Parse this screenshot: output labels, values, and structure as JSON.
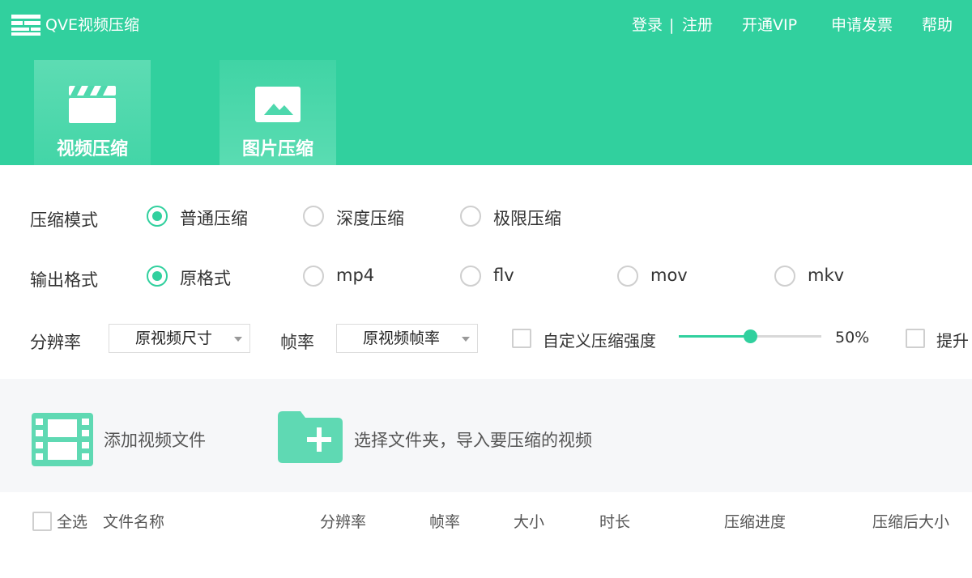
{
  "app": {
    "title": "QVE视频压缩"
  },
  "top_menu": {
    "login": "登录",
    "separator": "|",
    "register": "注册",
    "vip": "开通VIP",
    "invoice": "申请发票",
    "help": "帮助"
  },
  "tabs": [
    {
      "label": "视频压缩",
      "icon": "clapperboard-icon",
      "active": true
    },
    {
      "label": "图片压缩",
      "icon": "image-icon",
      "active": false
    }
  ],
  "compress_mode": {
    "label": "压缩模式",
    "options": [
      "普通压缩",
      "深度压缩",
      "极限压缩"
    ],
    "selected": "普通压缩"
  },
  "output_format": {
    "label": "输出格式",
    "options": [
      "原格式",
      "mp4",
      "flv",
      "mov",
      "mkv"
    ],
    "selected": "原格式"
  },
  "settings": {
    "resolution_label": "分辨率",
    "resolution_value": "原视频尺寸",
    "framerate_label": "帧率",
    "framerate_value": "原视频帧率",
    "custom_strength_label": "自定义压缩强度",
    "strength_value": "50%",
    "strength_fraction": 0.5,
    "extra_option_label": "提升"
  },
  "dropzone": {
    "add_video": "添加视频文件",
    "select_folder": "选择文件夹，导入要压缩的视频"
  },
  "list_header": {
    "select_all": "全选",
    "columns": [
      "文件名称",
      "分辨率",
      "帧率",
      "大小",
      "时长",
      "压缩进度",
      "压缩后大小"
    ]
  },
  "colors": {
    "accent": "#31d09e"
  }
}
